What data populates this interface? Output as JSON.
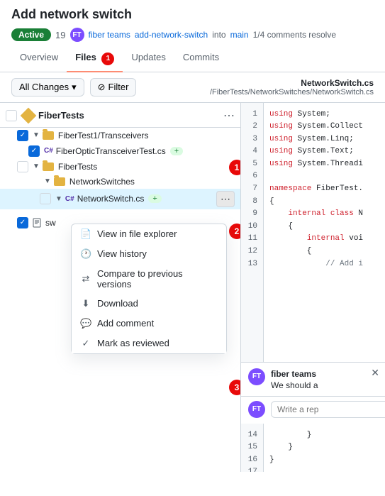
{
  "header": {
    "title": "Add network switch",
    "badge_active": "Active",
    "meta_number": "19",
    "author": "fiber teams",
    "branch_from": "add-network-switch",
    "into": "into",
    "branch_to": "main",
    "comments": "1/4 comments resolve"
  },
  "tabs": {
    "overview": "Overview",
    "files": "Files",
    "updates": "Updates",
    "commits": "Commits"
  },
  "toolbar": {
    "all_changes": "All Changes",
    "filter": "Filter",
    "file_name": "NetworkSwitch.cs",
    "file_path": "/FiberTests/NetworkSwitches/NetworkSwitch.cs"
  },
  "file_tree": {
    "root": "FiberTests",
    "items": [
      {
        "label": "FiberTest1/Transceivers",
        "type": "folder",
        "indent": 1,
        "checked": true
      },
      {
        "label": "FiberOpticTransceiverTest.cs",
        "type": "cs",
        "indent": 2,
        "checked": true,
        "plus": true
      },
      {
        "label": "FiberTests",
        "type": "folder",
        "indent": 1
      },
      {
        "label": "NetworkSwitches",
        "type": "folder",
        "indent": 2
      },
      {
        "label": "NetworkSwitch.cs",
        "type": "cs",
        "indent": 3,
        "checked": false,
        "highlighted": true,
        "plus": true
      },
      {
        "label": "sw",
        "type": "file",
        "indent": 1,
        "checked": true
      }
    ]
  },
  "context_menu": {
    "items": [
      {
        "icon": "file-explorer",
        "label": "View in file explorer"
      },
      {
        "icon": "history",
        "label": "View history"
      },
      {
        "icon": "compare",
        "label": "Compare to previous versions"
      },
      {
        "icon": "download",
        "label": "Download"
      },
      {
        "icon": "comment",
        "label": "Add comment"
      },
      {
        "icon": "check",
        "label": "Mark as reviewed"
      }
    ]
  },
  "code": {
    "lines": [
      {
        "num": "1",
        "text": "using System;"
      },
      {
        "num": "2",
        "text": "using System.Collect"
      },
      {
        "num": "3",
        "text": "using System.Linq;"
      },
      {
        "num": "4",
        "text": "using System.Text;"
      },
      {
        "num": "5",
        "text": "using System.Threadi"
      },
      {
        "num": "6",
        "text": ""
      },
      {
        "num": "7",
        "text": "namespace FiberTest."
      },
      {
        "num": "8",
        "text": "{"
      },
      {
        "num": "9",
        "text": "    internal class N"
      },
      {
        "num": "10",
        "text": "    {"
      },
      {
        "num": "11",
        "text": "        internal voi"
      },
      {
        "num": "12",
        "text": "        {"
      },
      {
        "num": "13",
        "text": "            // Add i"
      }
    ],
    "bottom_lines": [
      {
        "num": "14",
        "text": "        }"
      },
      {
        "num": "15",
        "text": "    }"
      },
      {
        "num": "16",
        "text": "}"
      },
      {
        "num": "17",
        "text": ""
      }
    ]
  },
  "comment": {
    "author": "fiber teams",
    "avatar_initials": "FT",
    "text": "We should a",
    "reply_placeholder": "Write a rep"
  },
  "badges": {
    "tab_circle": "1",
    "b1": "1",
    "b2": "2",
    "b3": "3"
  }
}
